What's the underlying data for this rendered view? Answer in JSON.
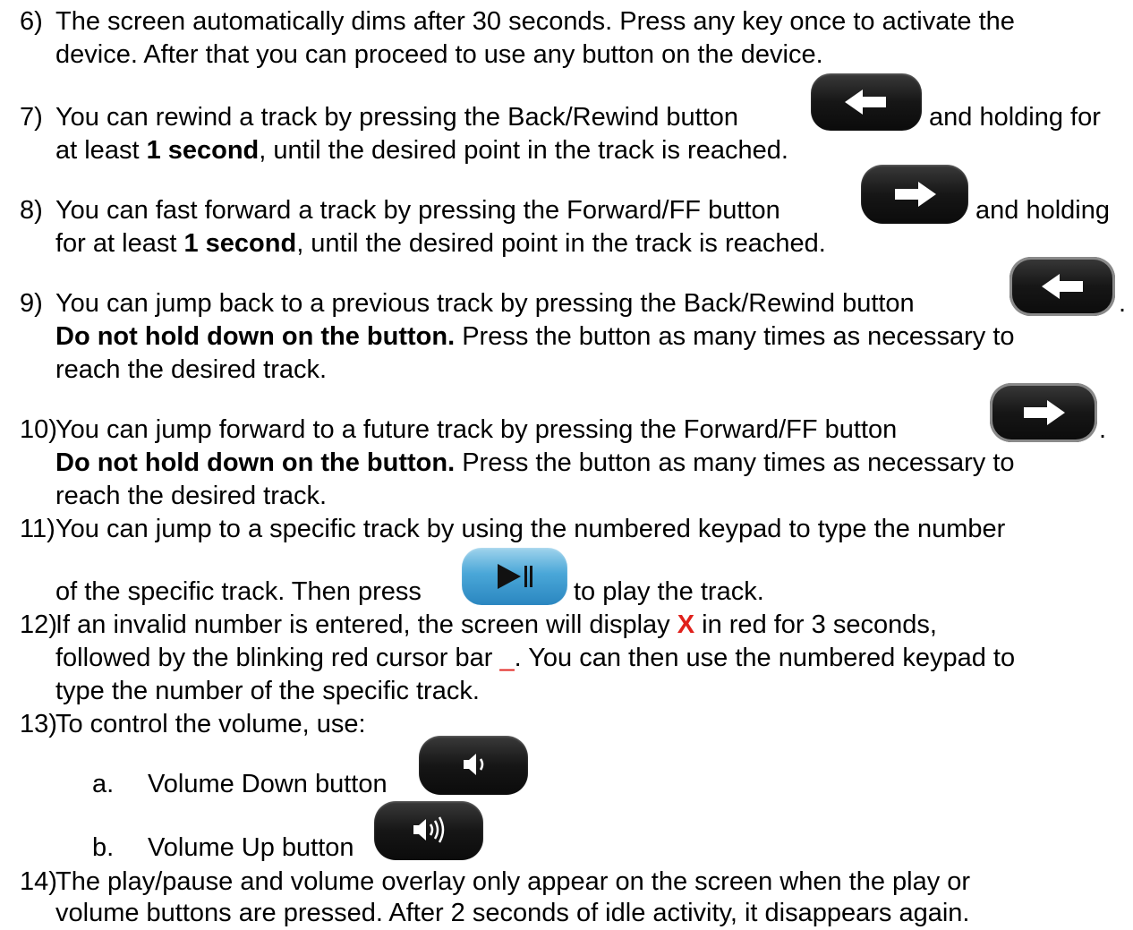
{
  "items": {
    "i6": {
      "num": "6)",
      "line1": "The screen automatically dims after 30 seconds. Press any key once to activate the",
      "line2": "device. After that you can proceed to use any button on the device."
    },
    "i7": {
      "num": "7)",
      "line1_a": "You can rewind a track by pressing the Back/Rewind button",
      "line1_b": "and holding for",
      "line2_a": "at least ",
      "line2_bold": "1 second",
      "line2_b": ", until the desired point in the track is reached."
    },
    "i8": {
      "num": "8)",
      "line1_a": "You can fast forward a track by pressing the Forward/FF button",
      "line1_b": "and holding",
      "line2_a": "for at least ",
      "line2_bold": "1 second",
      "line2_b": ", until the desired point in the track is reached."
    },
    "i9": {
      "num": "9)",
      "line1_a": "You can jump back to a previous track by pressing the Back/Rewind button",
      "line1_b": ".",
      "line2_bold": "Do not hold down on the button.",
      "line2_b": " Press the button as many times as necessary to",
      "line3": "reach the desired track."
    },
    "i10": {
      "num": "10)",
      "line1_a": "You can jump forward to a future track by pressing the Forward/FF button",
      "line1_b": ".",
      "line2_bold": "Do not hold down on the button.",
      "line2_b": " Press the button as many times as necessary to",
      "line3": "reach the desired track."
    },
    "i11": {
      "num": "11)",
      "line1": "You can jump to a specific track by using the numbered keypad to type the number",
      "line2_a": "of the specific track. Then press",
      "line2_b": "to play the track."
    },
    "i12": {
      "num": "12)",
      "line1_a": "If an invalid number is entered, the screen will display ",
      "line1_red": "X",
      "line1_b": " in red for 3 seconds,",
      "line2_a": "followed by the blinking red cursor bar ",
      "line2_red": "_",
      "line2_b": ".  You can then use the numbered keypad to",
      "line3": "type the number of the specific track."
    },
    "i13": {
      "num": "13)",
      "line1": "To control the volume, use:",
      "a_label": "a.",
      "a_text": "Volume Down button",
      "b_label": "b.",
      "b_text": "Volume Up button"
    },
    "i14": {
      "num": "14)",
      "line1": "The play/pause and volume overlay only appear on the screen when the play or",
      "line2": "volume buttons are pressed.  After 2 seconds of idle activity, it disappears again."
    }
  },
  "icons": {
    "back": "back-rewind-arrow-icon",
    "forward": "forward-ff-arrow-icon",
    "play_pause": "play-pause-icon",
    "volume_down": "volume-down-icon",
    "volume_up": "volume-up-icon"
  },
  "colors": {
    "text": "#000000",
    "accent_red": "#e0201b",
    "button_black": "#111111"
  }
}
